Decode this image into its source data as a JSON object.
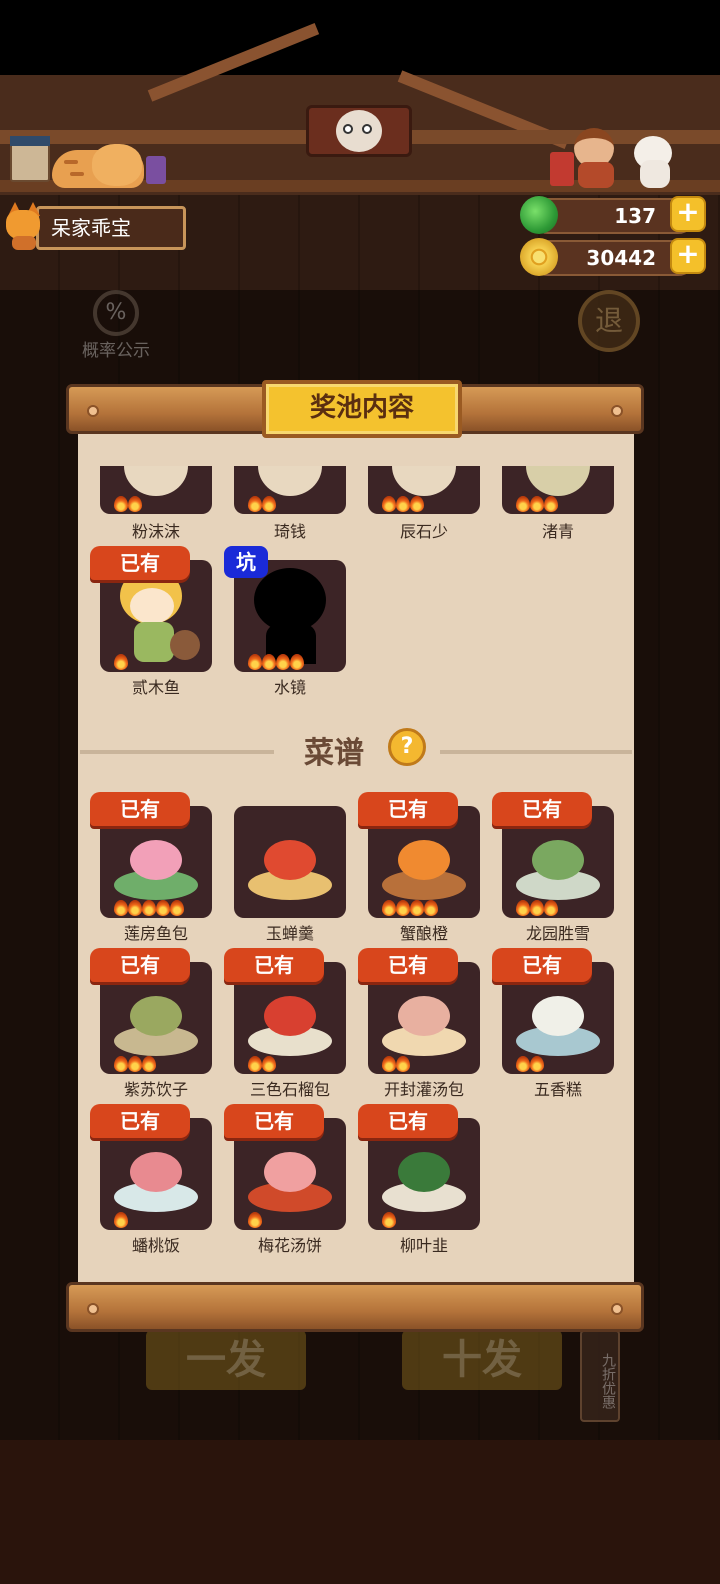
{
  "header": {
    "player_name": "呆家乖宝",
    "currencies": [
      {
        "name": "jade",
        "value": "137",
        "icon": "green-gem-icon",
        "color": "#3fb548"
      },
      {
        "name": "coin",
        "value": "30442",
        "icon": "copper-coin-icon",
        "color": "#f2c233"
      }
    ],
    "plus_label": "+"
  },
  "background": {
    "probability_label": "概率公示",
    "probability_symbol": "%",
    "exit_label": "退",
    "single_draw_label": "一发",
    "ten_draw_label": "十发",
    "discount_label": "九折优惠"
  },
  "panel": {
    "title": "奖池内容",
    "characters_partial": [
      {
        "name": "粉沫沫",
        "flames": 2
      },
      {
        "name": "琦钱",
        "flames": 2
      },
      {
        "name": "辰石少",
        "flames": 3
      },
      {
        "name": "渚青",
        "flames": 3
      }
    ],
    "characters": [
      {
        "name": "贰木鱼",
        "badge": "已有",
        "flames": 1
      },
      {
        "name": "水镜",
        "badge": "坑",
        "flames": 4
      }
    ],
    "recipe_section_title": "菜谱",
    "help_symbol": "?",
    "recipes": [
      {
        "name": "莲房鱼包",
        "badge": "已有",
        "flames": 5
      },
      {
        "name": "玉蝉羹",
        "badge": "",
        "flames": 0
      },
      {
        "name": "蟹酿橙",
        "badge": "已有",
        "flames": 4
      },
      {
        "name": "龙园胜雪",
        "badge": "已有",
        "flames": 3
      },
      {
        "name": "紫苏饮子",
        "badge": "已有",
        "flames": 3
      },
      {
        "name": "三色石榴包",
        "badge": "已有",
        "flames": 2
      },
      {
        "name": "开封灌汤包",
        "badge": "已有",
        "flames": 2
      },
      {
        "name": "五香糕",
        "badge": "已有",
        "flames": 2
      },
      {
        "name": "蟠桃饭",
        "badge": "已有",
        "flames": 1
      },
      {
        "name": "梅花汤饼",
        "badge": "已有",
        "flames": 1
      },
      {
        "name": "柳叶韭",
        "badge": "已有",
        "flames": 1
      }
    ]
  }
}
